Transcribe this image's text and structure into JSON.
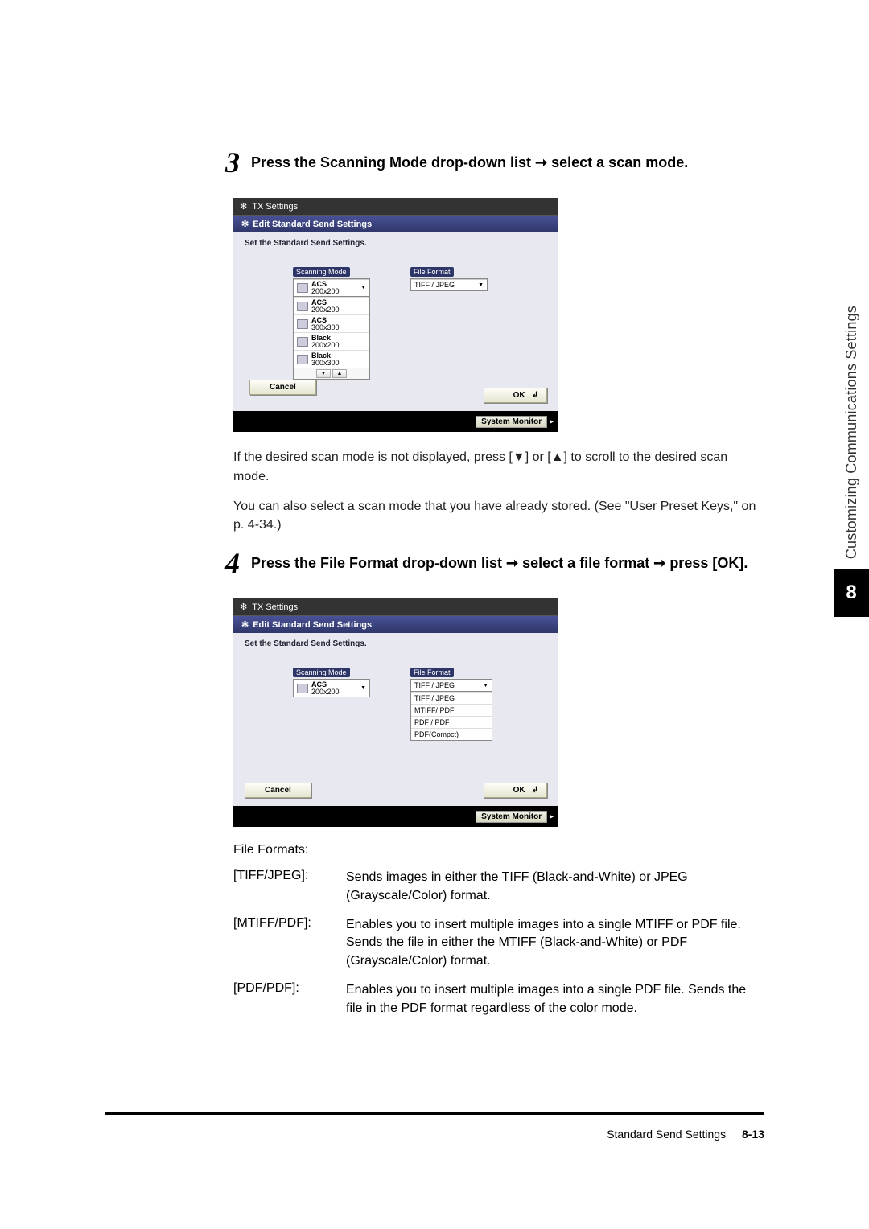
{
  "sideTab": {
    "label": "Customizing Communications Settings",
    "chapter": "8"
  },
  "footer": {
    "section": "Standard Send Settings",
    "page": "8-13"
  },
  "step3": {
    "num": "3",
    "text_a": "Press the Scanning Mode drop-down list ",
    "text_b": " select a scan mode.",
    "arrow": "➞",
    "after1": "If the desired scan mode is not displayed, press [▼] or [▲] to scroll to the desired scan mode.",
    "after2": "You can also select a scan mode that you have already stored. (See \"User Preset Keys,\" on p. 4-34.)"
  },
  "step4": {
    "num": "4",
    "text_a": "Press the File Format drop-down list ",
    "text_b": " select a file format ",
    "text_c": " press [OK].",
    "arrow": "➞",
    "fileFormatsLabel": "File Formats:",
    "formats": [
      {
        "label": "[TIFF/JPEG]:",
        "desc": "Sends images in either the TIFF (Black-and-White) or JPEG (Grayscale/Color) format."
      },
      {
        "label": "[MTIFF/PDF]:",
        "desc": "Enables you to insert multiple images into a single MTIFF or PDF file. Sends the file in either the MTIFF (Black-and-White) or PDF (Grayscale/Color) format."
      },
      {
        "label": "[PDF/PDF]:",
        "desc": "Enables you to insert multiple images into a single PDF file. Sends the file in the PDF format regardless of the color mode."
      }
    ]
  },
  "ss": {
    "titlebar": "TX Settings",
    "header": "Edit Standard Send Settings",
    "instr": "Set the Standard Send Settings.",
    "scanLabel": "Scanning Mode",
    "fileLabel": "File Format",
    "cancel": "Cancel",
    "ok": "OK",
    "sysmon": "System Monitor",
    "scanSelected": "ACS\n200x200",
    "scanList": [
      "ACS\n200x200",
      "ACS\n300x300",
      "Black\n200x200",
      "Black\n300x300"
    ],
    "fileSelected": "TIFF / JPEG",
    "fileList": [
      "TIFF / JPEG",
      "TIFF / JPEG",
      "MTIFF/ PDF",
      "PDF / PDF",
      "PDF(Compct)"
    ]
  }
}
